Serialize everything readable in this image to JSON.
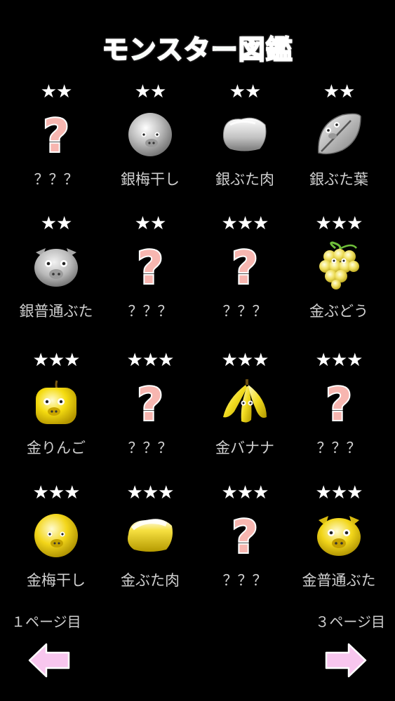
{
  "title": "モンスター図鑑",
  "monsters": [
    {
      "stars": "★★",
      "name": "？？？",
      "icon": "unknown-icon"
    },
    {
      "stars": "★★",
      "name": "銀梅干し",
      "icon": "silver-umeboshi-icon"
    },
    {
      "stars": "★★",
      "name": "銀ぶた肉",
      "icon": "silver-pork-icon"
    },
    {
      "stars": "★★",
      "name": "銀ぶた葉",
      "icon": "silver-leaf-icon"
    },
    {
      "stars": "★★",
      "name": "銀普通ぶた",
      "icon": "silver-pig-icon"
    },
    {
      "stars": "★★",
      "name": "？？？",
      "icon": "unknown-icon"
    },
    {
      "stars": "★★★",
      "name": "？？？",
      "icon": "unknown-icon"
    },
    {
      "stars": "★★★",
      "name": "金ぶどう",
      "icon": "gold-grape-icon"
    },
    {
      "stars": "★★★",
      "name": "金りんご",
      "icon": "gold-apple-icon"
    },
    {
      "stars": "★★★",
      "name": "？？？",
      "icon": "unknown-icon"
    },
    {
      "stars": "★★★",
      "name": "金バナナ",
      "icon": "gold-banana-icon"
    },
    {
      "stars": "★★★",
      "name": "？？？",
      "icon": "unknown-icon"
    },
    {
      "stars": "★★★",
      "name": "金梅干し",
      "icon": "gold-umeboshi-icon"
    },
    {
      "stars": "★★★",
      "name": "金ぶた肉",
      "icon": "gold-pork-icon"
    },
    {
      "stars": "★★★",
      "name": "？？？",
      "icon": "unknown-icon"
    },
    {
      "stars": "★★★",
      "name": "金普通ぶた",
      "icon": "gold-pig-icon"
    }
  ],
  "nav": {
    "prev_label": "１ページ目",
    "next_label": "３ページ目",
    "prev_icon": "arrow-left-icon",
    "next_icon": "arrow-right-icon"
  },
  "colors": {
    "title": "#86ec93",
    "unknown": "#f7b6b0",
    "arrow": "#f8c6ee",
    "silver": "#c8c8c8",
    "gold": "#f2d21a"
  }
}
